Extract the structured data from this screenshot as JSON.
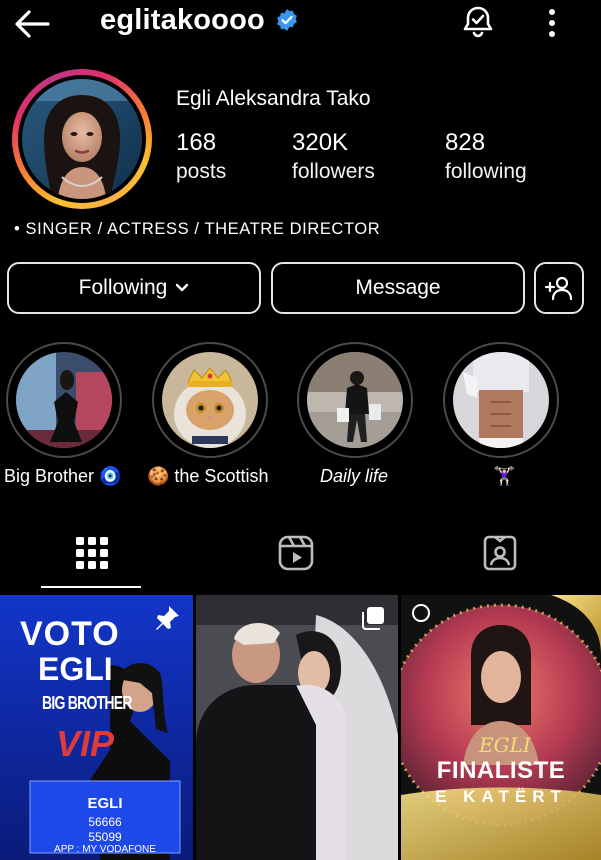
{
  "header": {
    "username": "eglitakoooo",
    "back_icon": "arrow-left-icon",
    "verified_icon": "verified-badge-icon",
    "notify_icon": "bell-check-icon",
    "more_icon": "more-vertical-icon"
  },
  "profile": {
    "full_name": "Egli Aleksandra Tako",
    "stats": [
      {
        "value": "168",
        "label": "posts"
      },
      {
        "value": "320K",
        "label": "followers"
      },
      {
        "value": "828",
        "label": "following"
      }
    ],
    "bio": "• SINGER / ACTRESS / THEATRE DIRECTOR"
  },
  "actions": {
    "following_label": "Following",
    "message_label": "Message",
    "add_user_icon": "add-person-icon"
  },
  "highlights": [
    {
      "label": "Big Brother 🧿"
    },
    {
      "label": "🍪 the Scottish"
    },
    {
      "label": "Daily life"
    },
    {
      "label": "🏋🏻‍♀️"
    }
  ],
  "tabs": [
    "grid-icon",
    "reels-icon",
    "tagged-icon"
  ],
  "posts": [
    {
      "title_line1": "VOTO",
      "title_line2": "EGLI",
      "show_line1": "BIG BROTHER",
      "show_line2": "VIP",
      "card_name": "EGLI",
      "code1": "56666",
      "code2": "55099",
      "app_text": "APP : MY VODAFONE",
      "pinned": true
    },
    {
      "multi": true
    },
    {
      "line1": "EGLI",
      "line2": "FINALISTE",
      "line3": "E KATËRT"
    }
  ],
  "colors": {
    "background": "#000000",
    "verified": "#3897f0",
    "ring_gradient": [
      "#f9c12e",
      "#f77737",
      "#e1306c",
      "#c13584"
    ]
  }
}
